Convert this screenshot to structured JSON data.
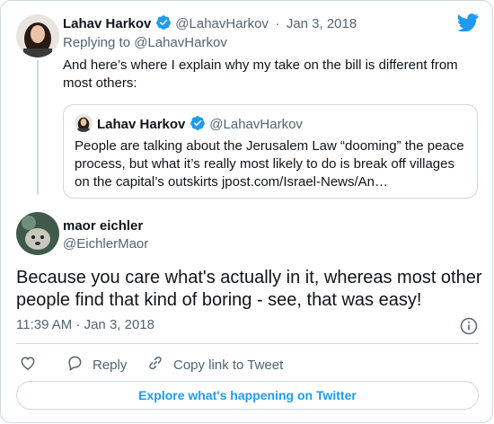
{
  "colors": {
    "accent": "#1d9bf0",
    "text": "#0f1419",
    "muted": "#536471",
    "border": "#cfd9de"
  },
  "parent_tweet": {
    "name": "Lahav Harkov",
    "handle": "@LahavHarkov",
    "separator": "·",
    "date": "Jan 3, 2018",
    "replying_to": "Replying to @LahavHarkov",
    "text": "And here’s where I explain why my take on the bill is different from most others:",
    "verified_icon": "verified-badge-icon"
  },
  "quoted_tweet": {
    "name": "Lahav Harkov",
    "handle": "@LahavHarkov",
    "text": "People are talking about the Jerusalem Law “dooming” the peace process, but what it’s really most likely to do is break off villages on the capital’s outskirts jpost.com/Israel-News/An…"
  },
  "main_tweet": {
    "name": "maor eichler",
    "handle": "@EichlerMaor",
    "text": "Because you care what's actually in it, whereas most other people find that kind of boring - see, that was easy!",
    "timestamp": "11:39 AM · Jan 3, 2018"
  },
  "actions": {
    "like_icon": "heart-icon",
    "reply_label": "Reply",
    "copy_link_label": "Copy link to Tweet"
  },
  "explore_button": "Explore what's happening on Twitter",
  "brand_icon": "twitter-bird-icon"
}
